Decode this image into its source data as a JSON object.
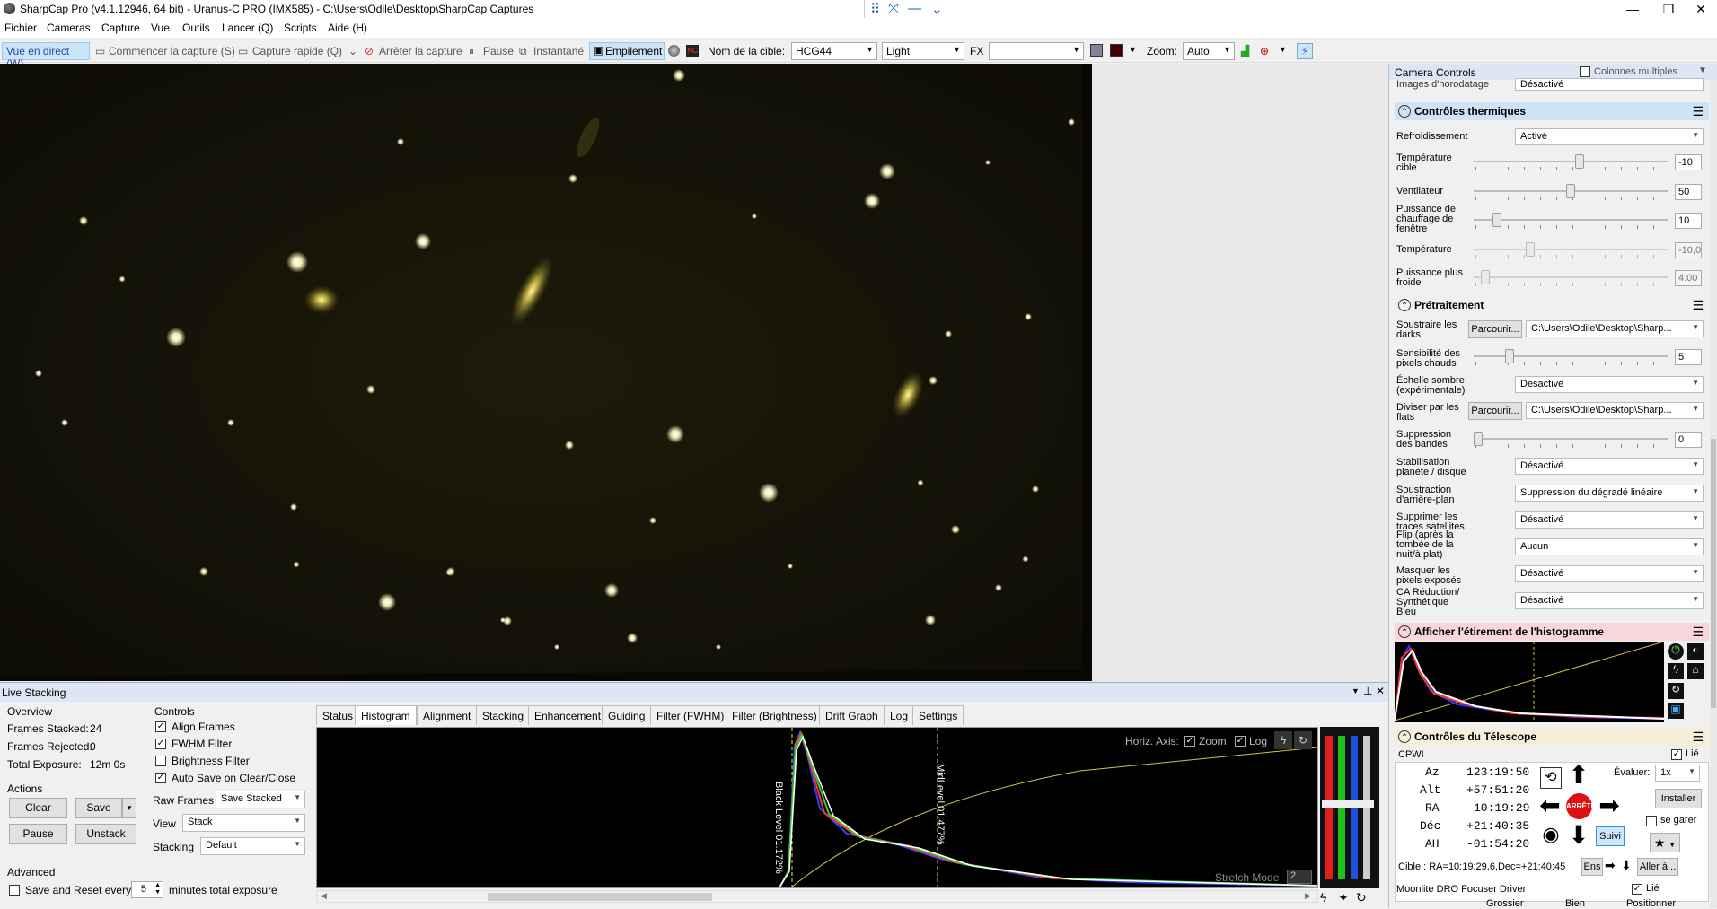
{
  "window": {
    "title": "SharpCap Pro (v4.1.12946, 64 bit) - Uranus-C PRO (IMX585) - C:\\Users\\Odile\\Desktop\\SharpCap Captures"
  },
  "menu": [
    "Fichier",
    "Cameras",
    "Capture",
    "Vue",
    "Outils",
    "Lancer (Q)",
    "Scripts",
    "Aide (H)"
  ],
  "toolbar": {
    "live_view": "Vue en direct (W)",
    "start_capture": "Commencer la capture (S)",
    "quick_capture": "Capture rapide (Q)",
    "stop_capture": "Arrêter la capture",
    "pause": "Pause",
    "snapshot": "Instantané",
    "stacking": "Empilement",
    "target_label": "Nom de la cible:",
    "target_value": "HCG44",
    "frame_type": "Light",
    "fx_label": "FX",
    "fx_value": "",
    "zoom_label": "Zoom:",
    "zoom_value": "Auto"
  },
  "right_panel": {
    "header": "Camera Controls",
    "multi_columns": "Colonnes multiples",
    "timestamp": {
      "label": "Images d'horodatage",
      "value": "Désactivé"
    },
    "thermal": {
      "title": "Contrôles thermiques",
      "cooling": {
        "label": "Refroidissement",
        "value": "Activé"
      },
      "target_temp": {
        "label": "Température cible",
        "value": "-10",
        "level": 0.55
      },
      "fan": {
        "label": "Ventilateur",
        "value": "50",
        "level": 0.5
      },
      "window_heater": {
        "label": "Puissance de chauffage de fenêtre",
        "value": "10",
        "level": 0.1
      },
      "temperature": {
        "label": "Température",
        "value": "-10,0",
        "level": 0.28
      },
      "colder_power": {
        "label": "Puissance plus froide",
        "value": "4.00",
        "level": 0.04
      }
    },
    "preprocessing": {
      "title": "Prétraitement",
      "subtract_darks": {
        "label": "Soustraire les darks",
        "button": "Parcourir...",
        "value": "C:\\Users\\Odile\\Desktop\\Sharp..."
      },
      "hot_pixel": {
        "label": "Sensibilité des pixels chauds",
        "value": "5",
        "level": 0.17
      },
      "dark_scale": {
        "label": "Échelle sombre (expérimentale)",
        "value": "Désactivé"
      },
      "flats": {
        "label": "Diviser par les flats",
        "button": "Parcourir...",
        "value": "C:\\Users\\Odile\\Desktop\\Sharp..."
      },
      "banding": {
        "label": "Suppression des bandes",
        "value": "0",
        "level": 0
      },
      "stabilisation": {
        "label": "Stabilisation planète / disque",
        "value": "Désactivé"
      },
      "background": {
        "label": "Soustraction d'arrière-plan",
        "value": "Suppression du dégradé linéaire"
      },
      "satellite": {
        "label": "Supprimer les traces satellites",
        "value": "Désactivé"
      },
      "flip": {
        "label": "Flip (après la tombée de la nuit/à plat)",
        "value": "Aucun"
      },
      "mask": {
        "label": "Masquer les pixels exposés",
        "value": "Désactivé"
      },
      "ca": {
        "label": "CA Réduction/ Synthétique Bleu",
        "value": "Désactivé"
      }
    },
    "histogram_stretch": {
      "title": "Afficher l'étirement de l'histogramme"
    },
    "telescope": {
      "title": "Contrôles du Télescope",
      "name": "CPWI",
      "linked": "Lié",
      "az": {
        "label": "Az",
        "value": "123:19:50"
      },
      "alt": {
        "label": "Alt",
        "value": "+57:51:20"
      },
      "ra": {
        "label": "RA",
        "value": "10:19:29"
      },
      "dec": {
        "label": "Déc",
        "value": "+21:40:35"
      },
      "ha": {
        "label": "AH",
        "value": "-01:54:20"
      },
      "rate_label": "Évaluer:",
      "rate_value": "1x",
      "install": "Installer",
      "stop": "ARRÊTE",
      "park": "se garer",
      "track": "Suivi",
      "target": "Cible : RA=10:19:29,6,Dec=+21:40:45",
      "ens": "Ens",
      "goto": "Aller à..."
    },
    "focuser": {
      "name": "Moonlite DRO Focuser Driver",
      "linked": "Lié",
      "col1": "Grossier",
      "col2": "Bien",
      "col3": "Positionner"
    }
  },
  "live_stacking": {
    "title": "Live Stacking",
    "overview": {
      "title": "Overview",
      "frames_stacked_label": "Frames Stacked:",
      "frames_stacked": "24",
      "frames_rejected_label": "Frames Rejected:",
      "frames_rejected": "0",
      "total_exposure_label": "Total Exposure:",
      "total_exposure": "12m 0s"
    },
    "actions": {
      "title": "Actions",
      "clear": "Clear",
      "save": "Save",
      "pause": "Pause",
      "unstack": "Unstack"
    },
    "advanced": {
      "title": "Advanced",
      "save_reset_label": "Save and Reset every",
      "minutes": "5",
      "minutes_suffix": "minutes total exposure"
    },
    "controls": {
      "title": "Controls",
      "align_frames": "Align Frames",
      "fwhm_filter": "FWHM Filter",
      "brightness_filter": "Brightness Filter",
      "auto_save": "Auto Save on Clear/Close",
      "raw_frames_label": "Raw Frames",
      "raw_frames_value": "Save Stacked",
      "view_label": "View",
      "view_value": "Stack",
      "stacking_label": "Stacking",
      "stacking_value": "Default"
    },
    "tabs": [
      "Status",
      "Histogram",
      "Alignment",
      "Stacking",
      "Enhancement",
      "Guiding",
      "Filter (FWHM)",
      "Filter (Brightness)",
      "Drift Graph",
      "Log",
      "Settings"
    ],
    "active_tab": "Histogram",
    "histogram": {
      "horiz_axis": "Horiz. Axis:",
      "zoom": "Zoom",
      "log": "Log",
      "black_level": "Black Level 01.172%",
      "mid_level": "MidLevel 01.477%",
      "stretch_mode": "Stretch Mode",
      "stretch_value": "2"
    }
  },
  "colors": {
    "thermal_header": "#cfe3f7",
    "histogram_header": "#f9d5dc",
    "telescope_header": "#f5f0dc",
    "accent": "#1e6fd9"
  }
}
